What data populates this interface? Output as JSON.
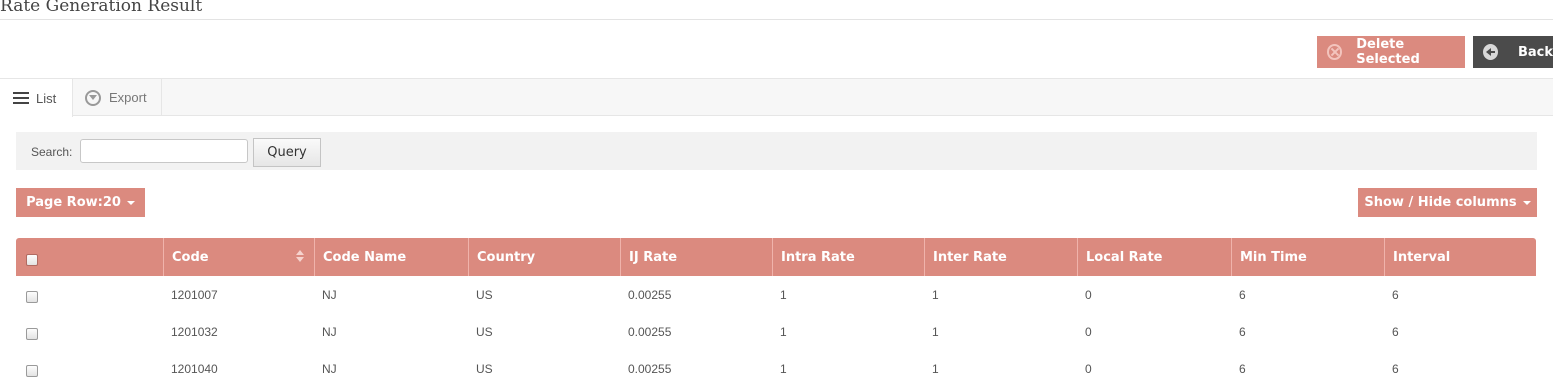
{
  "page": {
    "title": "Rate Generation Result"
  },
  "actions": {
    "delete_label": "Delete Selected",
    "back_label": "Back"
  },
  "tabs": [
    {
      "label": "List",
      "icon": "list-icon"
    },
    {
      "label": "Export",
      "icon": "download-circle-icon"
    }
  ],
  "search": {
    "label": "Search:",
    "value": "",
    "query_label": "Query"
  },
  "controls": {
    "page_row_label": "Page Row:20",
    "show_hide_label": "Show / Hide columns"
  },
  "colors": {
    "accent": "#db8a7f",
    "back_button": "#4b4b4b"
  },
  "table": {
    "columns": [
      "Code",
      "Code Name",
      "Country",
      "IJ Rate",
      "Intra Rate",
      "Inter Rate",
      "Local Rate",
      "Min Time",
      "Interval"
    ],
    "rows": [
      [
        "1201007",
        "NJ",
        "US",
        "0.00255",
        "1",
        "1",
        "0",
        "6",
        "6"
      ],
      [
        "1201032",
        "NJ",
        "US",
        "0.00255",
        "1",
        "1",
        "0",
        "6",
        "6"
      ],
      [
        "1201040",
        "NJ",
        "US",
        "0.00255",
        "1",
        "1",
        "0",
        "6",
        "6"
      ]
    ]
  }
}
